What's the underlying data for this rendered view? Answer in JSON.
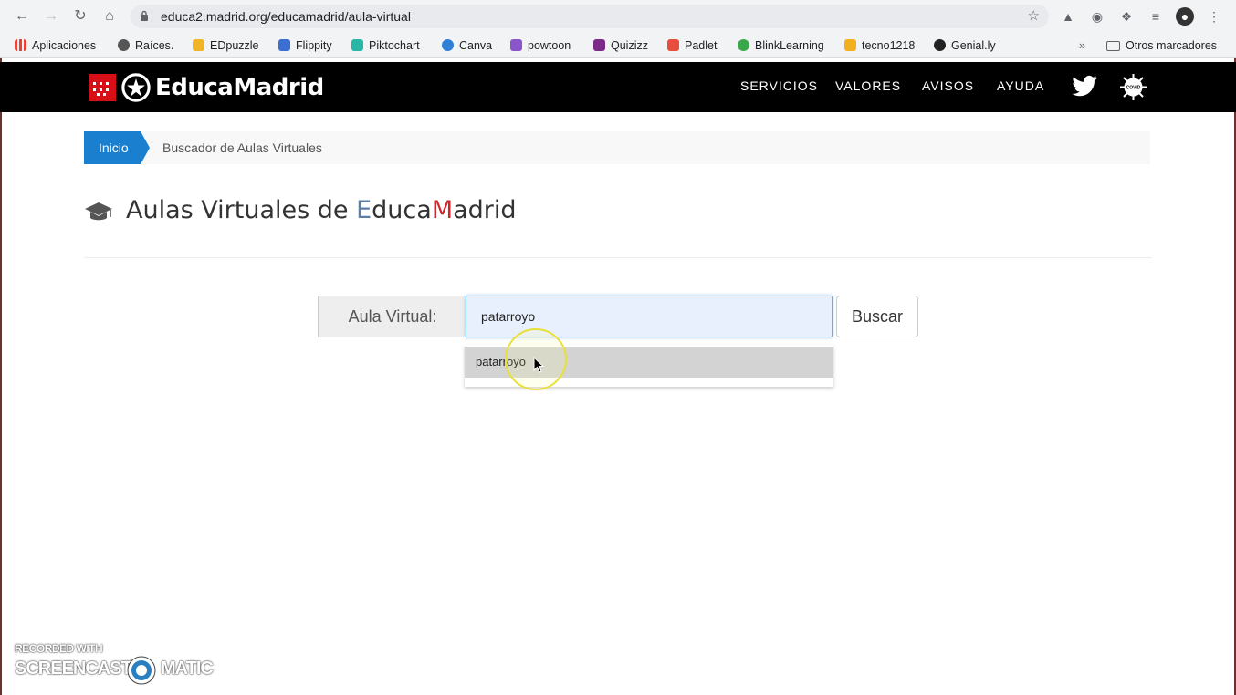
{
  "browser": {
    "url": "educa2.madrid.org/educamadrid/aula-virtual",
    "bookmarks": [
      {
        "label": "Aplicaciones",
        "color": "#5f6368"
      },
      {
        "label": "Raíces.",
        "color": "#555555"
      },
      {
        "label": "EDpuzzle",
        "color": "#f0b429"
      },
      {
        "label": "Flippity",
        "color": "#3b6fd1"
      },
      {
        "label": "Piktochart",
        "color": "#28b6a6"
      },
      {
        "label": "Canva",
        "color": "#2f7fd6"
      },
      {
        "label": "powtoon",
        "color": "#8a55c9"
      },
      {
        "label": "Quizizz",
        "color": "#7b2a87"
      },
      {
        "label": "Padlet",
        "color": "#e94e3c"
      },
      {
        "label": "BlinkLearning",
        "color": "#3aa84a"
      },
      {
        "label": "tecno1218",
        "color": "#f2b01e"
      },
      {
        "label": "Genial.ly",
        "color": "#222222"
      }
    ],
    "other_bookmarks": "Otros marcadores",
    "overflow": "»"
  },
  "site": {
    "logo_text": "EducaMadrid",
    "menu": [
      "SERVICIOS",
      "VALORES",
      "AVISOS",
      "AYUDA"
    ],
    "covid_label": "COVID"
  },
  "breadcrumb": {
    "home": "Inicio",
    "current": "Buscador de Aulas Virtuales"
  },
  "title": {
    "prefix": "Aulas Virtuales de ",
    "e": "E",
    "duca": "duca",
    "m": "M",
    "adrid": "adrid"
  },
  "search": {
    "label": "Aula Virtual:",
    "value": "patarroyo",
    "button": "Buscar",
    "suggestion": "patarroyo"
  },
  "watermark": {
    "top": "RECORDED WITH",
    "left": "SCREENCAST",
    "right": "MATIC"
  },
  "colors": {
    "accent": "#1a7fcf",
    "header_bg": "#000000",
    "brand_red": "#d80f16"
  }
}
